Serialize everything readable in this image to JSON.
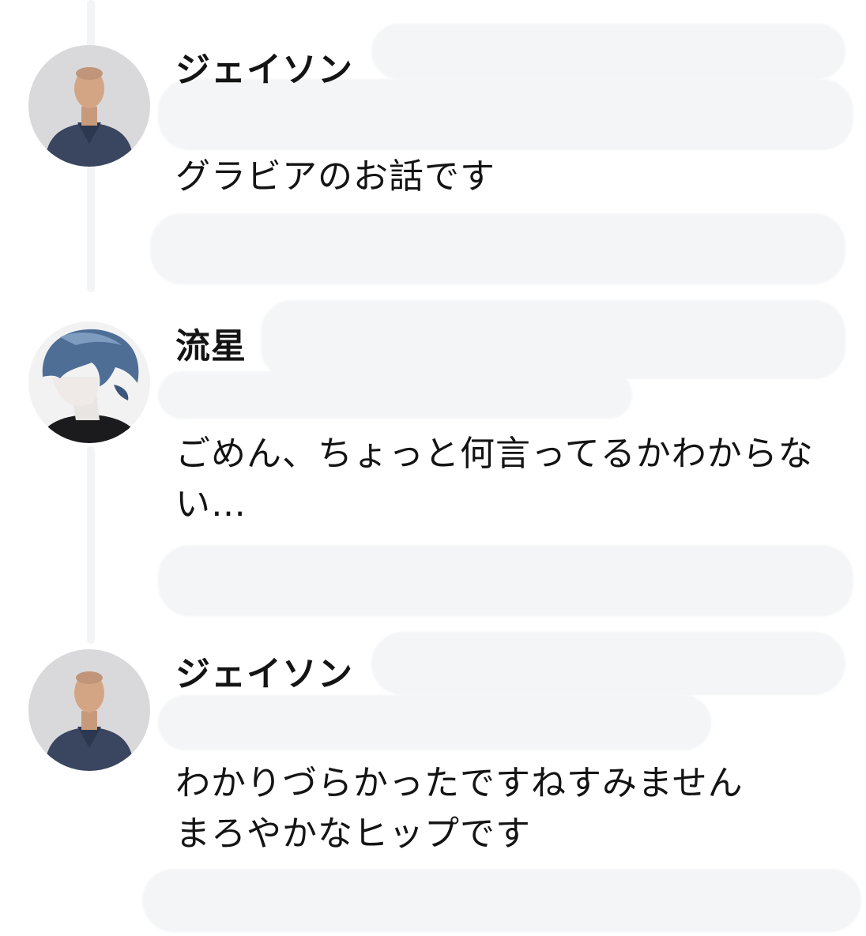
{
  "messages": [
    {
      "author": "ジェイソン",
      "avatar": "man-in-navy-shirt-avatar",
      "text": "グラビアのお話です"
    },
    {
      "author": "流星",
      "avatar": "anime-blue-hair-avatar",
      "text": "ごめん、ちょっと何言ってるかわからない…"
    },
    {
      "author": "ジェイソン",
      "avatar": "man-in-navy-shirt-avatar",
      "text_lines": [
        "わかりづらかったですねすみません",
        "まろやかなヒップです"
      ]
    }
  ],
  "colors": {
    "background": "#ffffff",
    "text": "#141414",
    "redaction": "#f4f5f6"
  }
}
